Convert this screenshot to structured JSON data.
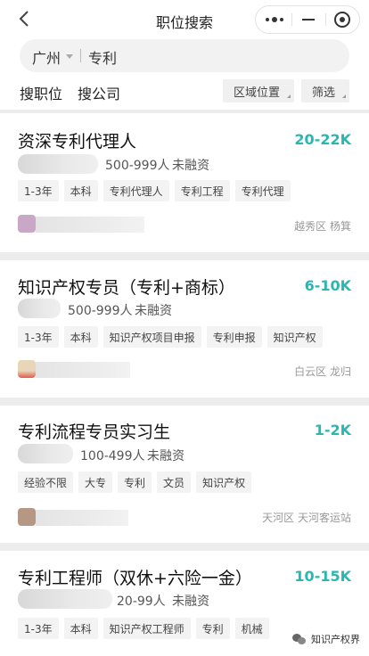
{
  "header": {
    "title": "职位搜索",
    "back_icon": "chevron-left-icon",
    "capsule": {
      "more_icon": "more-dots-icon",
      "minimize_icon": "minimize-icon",
      "close_icon": "target-circle-icon"
    }
  },
  "search": {
    "city": "广州",
    "query": "专利"
  },
  "filters": {
    "tab_jobs": "搜职位",
    "tab_companies": "搜公司",
    "region_button": "区域位置",
    "filter_button": "筛选"
  },
  "jobs": [
    {
      "title": "资深专利代理人",
      "salary": "20-22K",
      "size": "500-999人",
      "funding": "未融资",
      "tags": [
        "1-3年",
        "本科",
        "专利代理人",
        "专利工程",
        "专利代理"
      ],
      "location": "越秀区 杨箕"
    },
    {
      "title": "知识产权专员（专利+商标）",
      "salary": "6-10K",
      "size": "500-999人",
      "funding": "未融资",
      "tags": [
        "1-3年",
        "本科",
        "知识产权项目申报",
        "专利申报",
        "知识产权"
      ],
      "location": "白云区 龙归"
    },
    {
      "title": "专利流程专员实习生",
      "salary": "1-2K",
      "size": "100-499人",
      "funding": "未融资",
      "tags": [
        "经验不限",
        "大专",
        "专利",
        "文员",
        "知识产权"
      ],
      "location": "天河区 天河客运站"
    },
    {
      "title": "专利工程师（双休+六险一金）",
      "salary": "10-15K",
      "size": "20-99人",
      "funding": "未融资",
      "tags": [
        "1-3年",
        "本科",
        "知识产权工程师",
        "专利",
        "机械"
      ]
    }
  ],
  "watermark": {
    "text": "知识产权界"
  },
  "colors": {
    "salary": "#2ab7b1",
    "background": "#ececec"
  }
}
